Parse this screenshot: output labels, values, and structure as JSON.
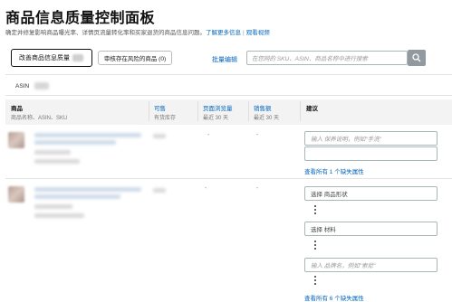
{
  "page": {
    "title": "商品信息质量控制面板",
    "description": "确定并修复影响商品曝光率、详情页流量转化率和买家退货的商品信息问题。",
    "learn_more": "了解更多信息",
    "separator": "|",
    "watch_video": "观看视频"
  },
  "tabs": [
    {
      "label": "改善商品信息质量"
    },
    {
      "label": "审核存在风险的商品 (0)"
    }
  ],
  "toolbar": {
    "bulk_edit": "批量编辑",
    "search_placeholder": "在您网的 SKU、ASIN、商品名称中进行搜索"
  },
  "filter": {
    "asin_label": "ASIN"
  },
  "table": {
    "headers": [
      {
        "main": "商品",
        "sub": "商品名称、ASIN、SKU"
      },
      {
        "main": "可售",
        "sub": "有货库存"
      },
      {
        "main": "页面浏览量",
        "sub": "最近 30 天"
      },
      {
        "main": "销售额",
        "sub": "最近 30 天"
      },
      {
        "main": "建议",
        "sub": ""
      }
    ],
    "rows": [
      {
        "dash_available": "-",
        "dash_sales": "-",
        "suggestions": [
          {
            "kind": "input",
            "placeholder": "输入 保养说明，例如\"手洗\""
          },
          {
            "kind": "select",
            "value": ""
          }
        ],
        "view_all": "查看所有 1 个缺失属性"
      },
      {
        "dash_views": "-",
        "dash_sales": "-",
        "suggestions": [
          {
            "kind": "select",
            "value": "选择 商品形状"
          },
          {
            "kind": "select",
            "value": "选择 材料"
          },
          {
            "kind": "input",
            "placeholder": "输入 品牌名，例如\"索尼\""
          }
        ],
        "view_all": "查看所有 6 个缺失属性"
      }
    ]
  },
  "colors": {
    "link": "#0066c0",
    "header_bg": "#f3f3f3",
    "search_button": "#909aa0"
  }
}
